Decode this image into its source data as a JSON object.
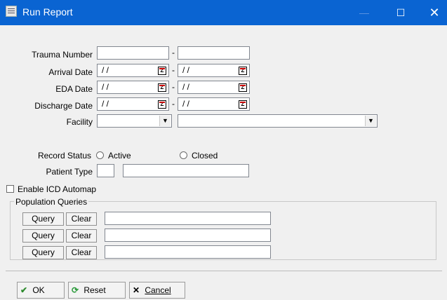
{
  "window": {
    "title": "Run Report",
    "controls": {
      "minimize": "—",
      "maximize": "☐",
      "close": "✕"
    }
  },
  "form": {
    "trauma_number": {
      "label": "Trauma Number",
      "from": "",
      "to": "",
      "separator": "-"
    },
    "arrival_date": {
      "label": "Arrival Date",
      "from": "/ /",
      "to": "/ /",
      "separator": "-"
    },
    "eda_date": {
      "label": "EDA Date",
      "from": "/ /",
      "to": "/ /",
      "separator": "-"
    },
    "discharge_date": {
      "label": "Discharge Date",
      "from": "/ /",
      "to": "/ /",
      "separator": "-"
    },
    "facility": {
      "label": "Facility",
      "code": "",
      "name": ""
    },
    "calendar_glyph": "Z",
    "dropdown_arrow": "▼",
    "record_status": {
      "label": "Record Status",
      "options": [
        "Active",
        "Closed"
      ],
      "selected": null
    },
    "patient_type": {
      "label": "Patient Type",
      "code": "",
      "description": ""
    },
    "enable_icd_automap": {
      "label": "Enable ICD Automap",
      "checked": false
    },
    "population_queries": {
      "label": "Population Queries",
      "rows": [
        {
          "query_label": "Query",
          "clear_label": "Clear",
          "value": ""
        },
        {
          "query_label": "Query",
          "clear_label": "Clear",
          "value": ""
        },
        {
          "query_label": "Query",
          "clear_label": "Clear",
          "value": ""
        }
      ]
    }
  },
  "buttons": {
    "ok": {
      "label": "OK",
      "icon": "check-icon",
      "color": "#2e8b2e"
    },
    "reset": {
      "label": "Reset",
      "icon": "refresh-icon",
      "color": "#2a9a3a"
    },
    "cancel": {
      "label": "Cancel",
      "icon": "x-icon"
    }
  },
  "colors": {
    "titlebar": "#0a64d2",
    "dialog_bg": "#f0f0f0"
  }
}
